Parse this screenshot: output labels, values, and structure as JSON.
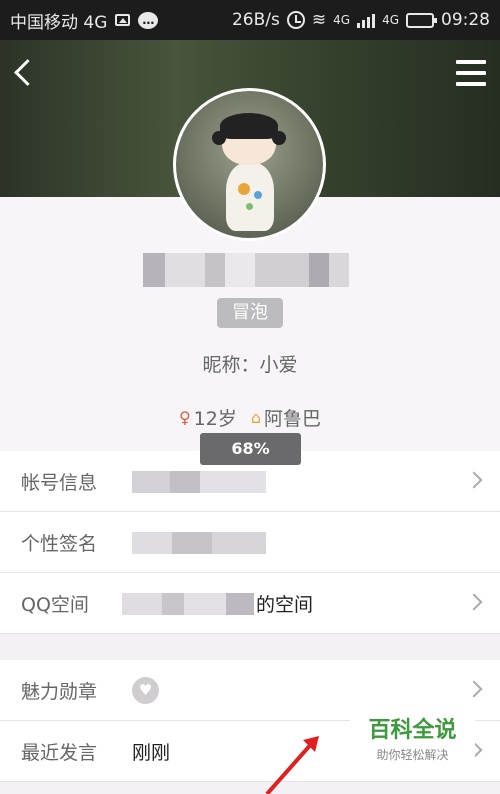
{
  "status_bar": {
    "carrier": "中国移动 4G",
    "speed": "26B/s",
    "net": "4G",
    "net2": "4G",
    "time": "09:28"
  },
  "profile": {
    "tag": "冒泡",
    "nickname": "昵称：小爱",
    "age": "12岁",
    "location": "阿鲁巴",
    "progress_label": "68%",
    "progress_value": 68
  },
  "rows_a": [
    {
      "label": "帐号信息",
      "suffix": ""
    },
    {
      "label": "个性签名",
      "suffix": ""
    },
    {
      "label": "QQ空间",
      "suffix": "的空间"
    }
  ],
  "rows_b": [
    {
      "label": "魅力勋章",
      "value": ""
    },
    {
      "label": "最近发言",
      "value": "刚刚"
    }
  ],
  "icons": {
    "back": "back-arrow-icon",
    "menu": "hamburger-menu-icon",
    "gender": "female-icon",
    "home": "home-icon",
    "medal": "heart-medal-icon"
  },
  "colors": {
    "accent_green": "#3c9a3c",
    "gender_red": "#e0603c",
    "home_orange": "#e7a53a"
  },
  "watermark": {
    "title": "百科全说",
    "subtitle": "助你轻松解决"
  }
}
